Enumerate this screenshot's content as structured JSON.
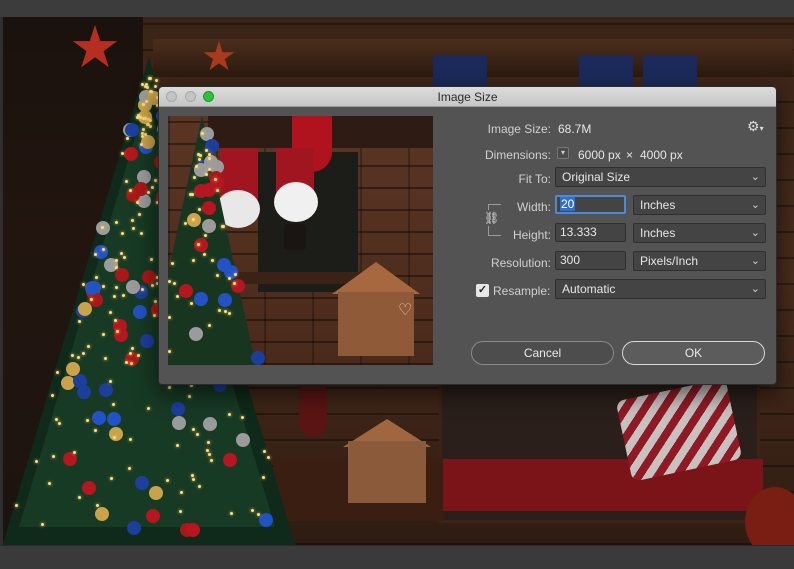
{
  "dialog": {
    "title": "Image Size",
    "image_size_label": "Image Size:",
    "image_size_value": "68.7M",
    "dimensions_label": "Dimensions:",
    "dimensions_width": "6000 px",
    "dimensions_sep": "×",
    "dimensions_height": "4000 px",
    "fit_to_label": "Fit To:",
    "fit_to_value": "Original Size",
    "width_label": "Width:",
    "width_value": "20",
    "width_unit": "Inches",
    "height_label": "Height:",
    "height_value": "13.333",
    "height_unit": "Inches",
    "resolution_label": "Resolution:",
    "resolution_value": "300",
    "resolution_unit": "Pixels/Inch",
    "resample_label": "Resample:",
    "resample_checked": true,
    "resample_value": "Automatic",
    "cancel_label": "Cancel",
    "ok_label": "OK"
  },
  "icons": {
    "gear": "gear-icon",
    "link": "link-icon",
    "chevron": "chevron-down-icon",
    "check": "checkmark-icon"
  },
  "colors": {
    "dialog_bg": "#535353",
    "focus_ring": "#4c89d8",
    "zoom_button": "#2ec13a"
  }
}
